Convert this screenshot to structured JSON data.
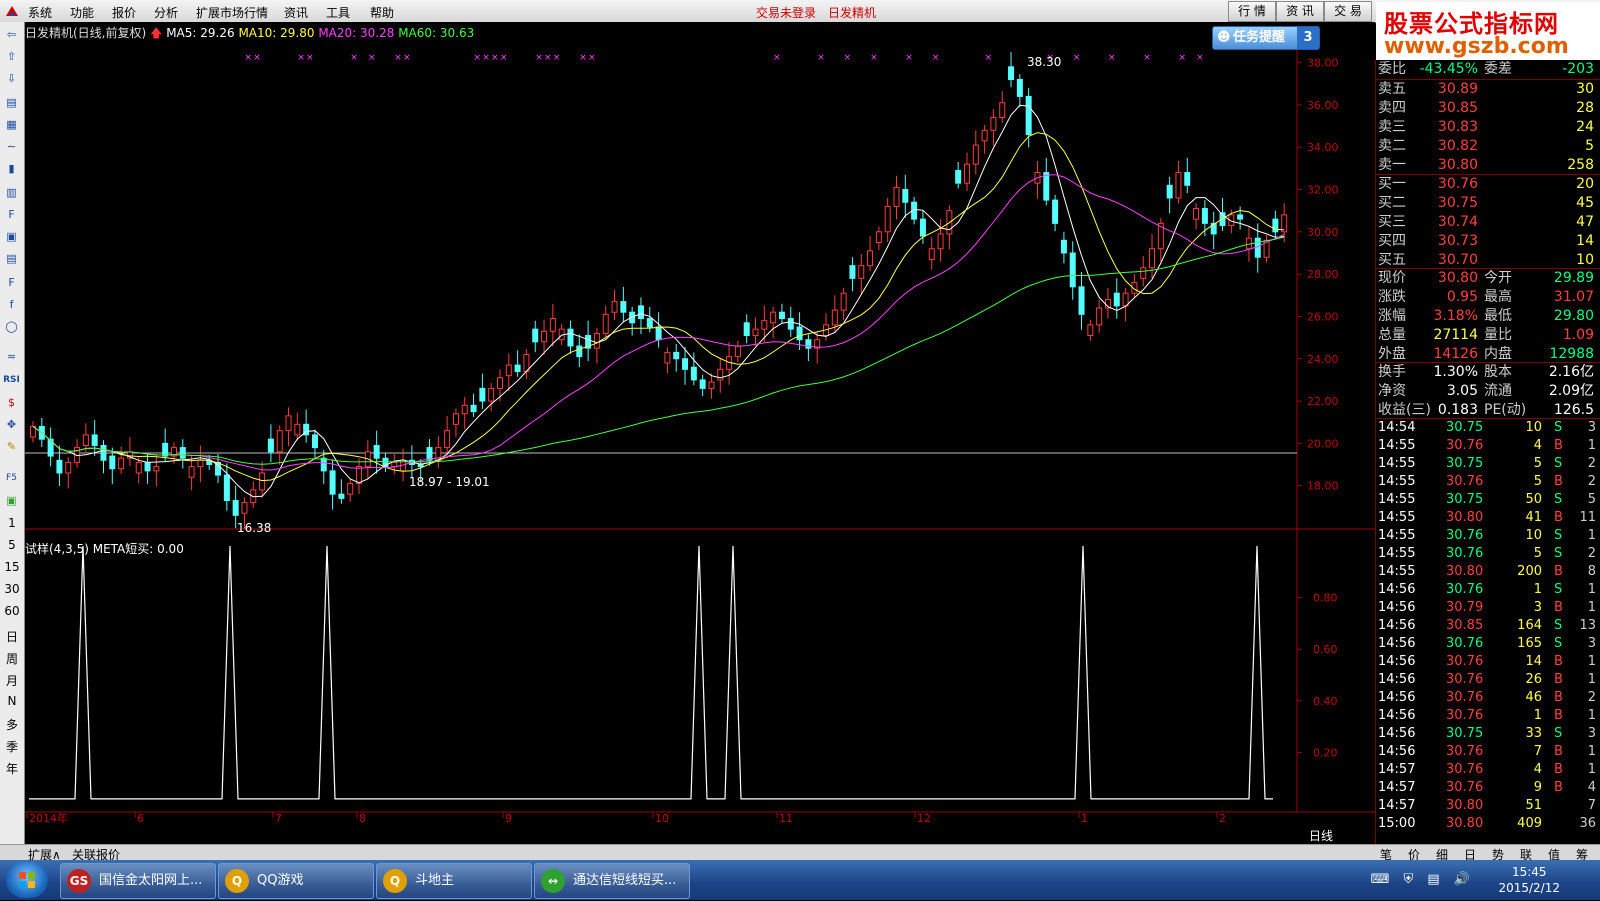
{
  "menu": {
    "items": [
      "系统",
      "功能",
      "报价",
      "分析",
      "扩展市场行情",
      "资讯",
      "工具",
      "帮助"
    ],
    "status_left": "交易未登录",
    "status_right": "日发精机",
    "tabs": [
      "行 情",
      "资 讯",
      "交 易"
    ]
  },
  "logo": {
    "line1": "股票公式指标网",
    "line2": "www.gszb.com"
  },
  "chart_header": {
    "title": "日发精机(日线,前复权)",
    "ma5": "MA5: 29.26",
    "ma10": "MA10: 29.80",
    "ma20": "MA20: 30.28",
    "ma60": "MA60: 30.63",
    "colors": {
      "ma5": "#ffffff",
      "ma10": "#ffff40",
      "ma20": "#ff40ff",
      "ma60": "#40ff40"
    }
  },
  "reminder": {
    "label": "任务提醒",
    "count": "3"
  },
  "annotations": {
    "high": "38.30",
    "low": "16.38",
    "range": "18.97 - 19.01"
  },
  "indicator": {
    "label": "试样(4,3,5) META短买: 0.00"
  },
  "period_label": "日线",
  "left_toolbar_labels": [
    "1",
    "5",
    "15",
    "30",
    "60",
    "日",
    "周",
    "月",
    "N",
    "多",
    "季",
    "年"
  ],
  "chart_data": [
    {
      "type": "candlestick",
      "title": "日发精机(日线,前复权)",
      "y_ticks": [
        "38.00",
        "36.00",
        "34.00",
        "32.00",
        "30.00",
        "28.00",
        "26.00",
        "24.00",
        "22.00",
        "20.00",
        "18.00"
      ],
      "ylim": [
        16,
        38.5
      ],
      "x_labels": [
        "2014年",
        "6",
        "7",
        "8",
        "9",
        "10",
        "11",
        "12",
        "1",
        "2"
      ],
      "close_approx": [
        20.8,
        20.2,
        19.4,
        18.6,
        19.1,
        19.8,
        20.4,
        19.9,
        19.2,
        18.8,
        19.3,
        19.6,
        19.1,
        18.7,
        18.9,
        19.4,
        19.8,
        19.3,
        18.9,
        19.2,
        19.0,
        18.5,
        17.3,
        16.6,
        17.2,
        17.8,
        18.6,
        19.6,
        20.6,
        21.3,
        20.9,
        20.4,
        19.8,
        18.7,
        17.6,
        17.4,
        18.1,
        18.9,
        19.6,
        19.3,
        18.9,
        19.1,
        19.2,
        19.0,
        18.9,
        19.2,
        19.8,
        20.6,
        21.4,
        21.8,
        21.5,
        22.0,
        22.6,
        23.1,
        23.7,
        23.4,
        24.2,
        24.8,
        25.3,
        25.9,
        25.4,
        24.6,
        24.1,
        24.5,
        25.2,
        26.1,
        26.7,
        26.2,
        25.7,
        25.9,
        25.5,
        24.9,
        24.3,
        24.0,
        23.5,
        23.0,
        22.6,
        22.9,
        23.5,
        24.1,
        24.6,
        25.1,
        25.4,
        25.8,
        26.2,
        25.9,
        25.4,
        24.9,
        24.5,
        24.9,
        25.6,
        26.3,
        27.1,
        27.8,
        28.4,
        29.1,
        30.0,
        31.2,
        32.1,
        31.4,
        30.6,
        29.8,
        29.2,
        29.9,
        31.0,
        32.3,
        33.2,
        34.1,
        34.8,
        35.4,
        36.1,
        37.2,
        36.4,
        34.6,
        32.8,
        31.5,
        30.4,
        29.0,
        27.4,
        26.1,
        25.6,
        26.4,
        26.8,
        26.5,
        27.1,
        27.6,
        28.3,
        29.2,
        30.4,
        31.6,
        32.8,
        32.2,
        31.1,
        30.4,
        29.9,
        30.3,
        30.8,
        30.6,
        29.7,
        28.8,
        29.6,
        30.0,
        30.8
      ],
      "series": [
        {
          "name": "MA5",
          "color": "#ffffff"
        },
        {
          "name": "MA10",
          "color": "#ffff40"
        },
        {
          "name": "MA20",
          "color": "#ff40ff"
        },
        {
          "name": "MA60",
          "color": "#40ff40"
        }
      ],
      "grid": false
    },
    {
      "type": "line",
      "title": "试样(4,3,5) META短买: 0.00",
      "y_ticks": [
        "0.80",
        "0.60",
        "0.40",
        "0.20"
      ],
      "ylim": [
        0,
        1
      ],
      "spike_indices": [
        11,
        39,
        59,
        135,
        139,
        204,
        238
      ]
    }
  ],
  "quote": {
    "weibi": {
      "label": "委比",
      "value": "-43.45%",
      "label2": "委差",
      "value2": "-203"
    },
    "asks": [
      {
        "label": "卖五",
        "price": "30.89",
        "vol": "30"
      },
      {
        "label": "卖四",
        "price": "30.85",
        "vol": "28"
      },
      {
        "label": "卖三",
        "price": "30.83",
        "vol": "24"
      },
      {
        "label": "卖二",
        "price": "30.82",
        "vol": "5"
      },
      {
        "label": "卖一",
        "price": "30.80",
        "vol": "258"
      }
    ],
    "bids": [
      {
        "label": "买一",
        "price": "30.76",
        "vol": "20"
      },
      {
        "label": "买二",
        "price": "30.75",
        "vol": "45"
      },
      {
        "label": "买三",
        "price": "30.74",
        "vol": "47"
      },
      {
        "label": "买四",
        "price": "30.73",
        "vol": "14"
      },
      {
        "label": "买五",
        "price": "30.70",
        "vol": "10"
      }
    ],
    "stats": [
      {
        "l1": "现价",
        "v1": "30.80",
        "c1": "red",
        "l2": "今开",
        "v2": "29.89",
        "c2": "grn"
      },
      {
        "l1": "涨跌",
        "v1": "0.95",
        "c1": "red",
        "l2": "最高",
        "v2": "31.07",
        "c2": "red"
      },
      {
        "l1": "涨幅",
        "v1": "3.18%",
        "c1": "red",
        "l2": "最低",
        "v2": "29.80",
        "c2": "grn"
      },
      {
        "l1": "总量",
        "v1": "27114",
        "c1": "yel",
        "l2": "量比",
        "v2": "1.09",
        "c2": "red"
      },
      {
        "l1": "外盘",
        "v1": "14126",
        "c1": "red",
        "l2": "内盘",
        "v2": "12988",
        "c2": "grn"
      }
    ],
    "fundamentals": [
      {
        "l1": "换手",
        "v1": "1.30%",
        "l2": "股本",
        "v2": "2.16亿"
      },
      {
        "l1": "净资",
        "v1": "3.05",
        "l2": "流通",
        "v2": "2.09亿"
      },
      {
        "l1": "收益(三)",
        "v1": "0.183",
        "l2": "PE(动)",
        "v2": "126.5"
      }
    ],
    "ticks": [
      {
        "t": "14:54",
        "p": "30.75",
        "pc": "grn",
        "v": "10",
        "s": "S",
        "n": "3"
      },
      {
        "t": "14:55",
        "p": "30.76",
        "pc": "red",
        "v": "4",
        "s": "B",
        "n": "1"
      },
      {
        "t": "14:55",
        "p": "30.75",
        "pc": "grn",
        "v": "5",
        "s": "S",
        "n": "2"
      },
      {
        "t": "14:55",
        "p": "30.76",
        "pc": "red",
        "v": "5",
        "s": "B",
        "n": "2"
      },
      {
        "t": "14:55",
        "p": "30.75",
        "pc": "grn",
        "v": "50",
        "s": "S",
        "n": "5"
      },
      {
        "t": "14:55",
        "p": "30.80",
        "pc": "red",
        "v": "41",
        "s": "B",
        "n": "11"
      },
      {
        "t": "14:55",
        "p": "30.76",
        "pc": "grn",
        "v": "10",
        "s": "S",
        "n": "1"
      },
      {
        "t": "14:55",
        "p": "30.76",
        "pc": "grn",
        "v": "5",
        "s": "S",
        "n": "2"
      },
      {
        "t": "14:55",
        "p": "30.80",
        "pc": "red",
        "v": "200",
        "s": "B",
        "n": "8"
      },
      {
        "t": "14:56",
        "p": "30.76",
        "pc": "grn",
        "v": "1",
        "s": "S",
        "n": "1"
      },
      {
        "t": "14:56",
        "p": "30.79",
        "pc": "red",
        "v": "3",
        "s": "B",
        "n": "1"
      },
      {
        "t": "14:56",
        "p": "30.85",
        "pc": "red",
        "v": "164",
        "s": "S",
        "n": "13"
      },
      {
        "t": "14:56",
        "p": "30.76",
        "pc": "grn",
        "v": "165",
        "s": "S",
        "n": "3"
      },
      {
        "t": "14:56",
        "p": "30.76",
        "pc": "red",
        "v": "14",
        "s": "B",
        "n": "1"
      },
      {
        "t": "14:56",
        "p": "30.76",
        "pc": "red",
        "v": "26",
        "s": "B",
        "n": "1"
      },
      {
        "t": "14:56",
        "p": "30.76",
        "pc": "red",
        "v": "46",
        "s": "B",
        "n": "2"
      },
      {
        "t": "14:56",
        "p": "30.76",
        "pc": "red",
        "v": "1",
        "s": "B",
        "n": "1"
      },
      {
        "t": "14:56",
        "p": "30.75",
        "pc": "grn",
        "v": "33",
        "s": "S",
        "n": "3"
      },
      {
        "t": "14:56",
        "p": "30.76",
        "pc": "red",
        "v": "7",
        "s": "B",
        "n": "1"
      },
      {
        "t": "14:57",
        "p": "30.76",
        "pc": "red",
        "v": "4",
        "s": "B",
        "n": "1"
      },
      {
        "t": "14:57",
        "p": "30.76",
        "pc": "red",
        "v": "9",
        "s": "B",
        "n": "4"
      },
      {
        "t": "14:57",
        "p": "30.80",
        "pc": "red",
        "v": "51",
        "s": "",
        "n": "7"
      },
      {
        "t": "15:00",
        "p": "30.80",
        "pc": "red",
        "v": "409",
        "s": "",
        "n": "36"
      }
    ],
    "bottom_tabs": [
      "笔",
      "价",
      "细",
      "日",
      "势",
      "联",
      "值",
      "筹"
    ]
  },
  "bottom_bar": {
    "tab1": "扩展∧",
    "tab2": "关联报价"
  },
  "taskbar": {
    "items": [
      {
        "label": "国信金太阳网上...",
        "icon": "GS",
        "color": "#c02020"
      },
      {
        "label": "QQ游戏",
        "icon": "Q",
        "color": "#e0a000"
      },
      {
        "label": "斗地主",
        "icon": "Q",
        "color": "#e0a000"
      },
      {
        "label": "通达信短线短买...",
        "icon": "↔",
        "color": "#30a030"
      }
    ],
    "time": "15:45",
    "date": "2015/2/12"
  }
}
